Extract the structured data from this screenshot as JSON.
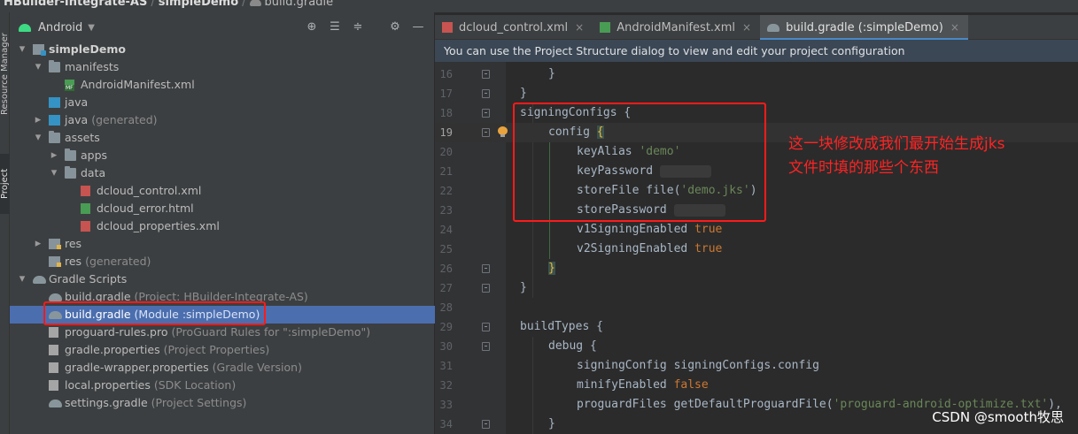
{
  "title_bar": {
    "project": "HBuilder-Integrate-AS",
    "module": "simpleDemo",
    "file": "build.gradle"
  },
  "tool_windows": {
    "resource_manager": "Resource Manager",
    "project": "Project"
  },
  "project_panel": {
    "view_mode": "Android",
    "tree": [
      {
        "label": "simpleDemo",
        "hint": "",
        "depth": 0,
        "arrow": "down",
        "icon": "module-icon",
        "bold": true
      },
      {
        "label": "manifests",
        "hint": "",
        "depth": 1,
        "arrow": "down",
        "icon": "folder-icon"
      },
      {
        "label": "AndroidManifest.xml",
        "hint": "",
        "depth": 2,
        "arrow": "",
        "icon": "manifest-icon"
      },
      {
        "label": "java",
        "hint": "",
        "depth": 1,
        "arrow": "",
        "icon": "source-folder-icon"
      },
      {
        "label": "java",
        "hint": "(generated)",
        "depth": 1,
        "arrow": "right",
        "icon": "generated-folder-icon"
      },
      {
        "label": "assets",
        "hint": "",
        "depth": 1,
        "arrow": "down",
        "icon": "folder-icon"
      },
      {
        "label": "apps",
        "hint": "",
        "depth": 2,
        "arrow": "right",
        "icon": "folder-icon"
      },
      {
        "label": "data",
        "hint": "",
        "depth": 2,
        "arrow": "down",
        "icon": "folder-icon"
      },
      {
        "label": "dcloud_control.xml",
        "hint": "",
        "depth": 3,
        "arrow": "",
        "icon": "xml-file-icon"
      },
      {
        "label": "dcloud_error.html",
        "hint": "",
        "depth": 3,
        "arrow": "",
        "icon": "html-file-icon"
      },
      {
        "label": "dcloud_properties.xml",
        "hint": "",
        "depth": 3,
        "arrow": "",
        "icon": "xml-file-icon"
      },
      {
        "label": "res",
        "hint": "",
        "depth": 1,
        "arrow": "right",
        "icon": "res-folder-icon"
      },
      {
        "label": "res",
        "hint": "(generated)",
        "depth": 1,
        "arrow": "",
        "icon": "res-folder-icon"
      },
      {
        "label": "Gradle Scripts",
        "hint": "",
        "depth": 0,
        "arrow": "down",
        "icon": "gradle-icon"
      },
      {
        "label": "build.gradle",
        "hint": "(Project: HBuilder-Integrate-AS)",
        "depth": 1,
        "arrow": "",
        "icon": "gradle-icon"
      },
      {
        "label": "build.gradle",
        "hint": "(Module :simpleDemo)",
        "depth": 1,
        "arrow": "",
        "icon": "gradle-icon",
        "selected": true
      },
      {
        "label": "proguard-rules.pro",
        "hint": "(ProGuard Rules for \":simpleDemo\")",
        "depth": 1,
        "arrow": "",
        "icon": "proguard-file-icon"
      },
      {
        "label": "gradle.properties",
        "hint": "(Project Properties)",
        "depth": 1,
        "arrow": "",
        "icon": "properties-file-icon"
      },
      {
        "label": "gradle-wrapper.properties",
        "hint": "(Gradle Version)",
        "depth": 1,
        "arrow": "",
        "icon": "properties-file-icon"
      },
      {
        "label": "local.properties",
        "hint": "(SDK Location)",
        "depth": 1,
        "arrow": "",
        "icon": "properties-file-icon"
      },
      {
        "label": "settings.gradle",
        "hint": "(Project Settings)",
        "depth": 1,
        "arrow": "",
        "icon": "gradle-icon"
      }
    ]
  },
  "editor": {
    "tabs": [
      {
        "label": "dcloud_control.xml",
        "icon": "xml-file-icon",
        "active": false
      },
      {
        "label": "AndroidManifest.xml",
        "icon": "manifest-icon",
        "active": false
      },
      {
        "label": "build.gradle (:simpleDemo)",
        "icon": "gradle-icon",
        "active": true
      }
    ],
    "notification": "You can use the Project Structure dialog to view and edit your project configuration",
    "caret_line": 19,
    "lines": [
      {
        "n": 16,
        "indent": 1,
        "tokens": [
          [
            "p",
            "}"
          ]
        ],
        "fold": true
      },
      {
        "n": 17,
        "indent": 0,
        "tokens": [
          [
            "p",
            "}"
          ]
        ],
        "fold": true
      },
      {
        "n": 18,
        "indent": 0,
        "tokens": [
          [
            "p",
            "signingConfigs {"
          ]
        ],
        "fold": true
      },
      {
        "n": 19,
        "indent": 1,
        "tokens": [
          [
            "p",
            "config "
          ],
          [
            "hl",
            "{"
          ]
        ],
        "fold": true,
        "bulb": true
      },
      {
        "n": 20,
        "indent": 2,
        "tokens": [
          [
            "p",
            "keyAlias "
          ],
          [
            "s",
            "'demo'"
          ]
        ]
      },
      {
        "n": 21,
        "indent": 2,
        "tokens": [
          [
            "p",
            "keyPassword "
          ],
          [
            "blur",
            ""
          ]
        ]
      },
      {
        "n": 22,
        "indent": 2,
        "tokens": [
          [
            "p",
            "storeFile file("
          ],
          [
            "s",
            "'demo.jks'"
          ],
          [
            "p",
            ")"
          ]
        ]
      },
      {
        "n": 23,
        "indent": 2,
        "tokens": [
          [
            "p",
            "storePassword "
          ],
          [
            "blur",
            ""
          ]
        ]
      },
      {
        "n": 24,
        "indent": 2,
        "tokens": [
          [
            "p",
            "v1SigningEnabled "
          ],
          [
            "k",
            "true"
          ]
        ]
      },
      {
        "n": 25,
        "indent": 2,
        "tokens": [
          [
            "p",
            "v2SigningEnabled "
          ],
          [
            "k",
            "true"
          ]
        ]
      },
      {
        "n": 26,
        "indent": 1,
        "tokens": [
          [
            "hl",
            "}"
          ]
        ],
        "fold": true
      },
      {
        "n": 27,
        "indent": 0,
        "tokens": [
          [
            "p",
            "}"
          ]
        ],
        "fold": true
      },
      {
        "n": 28,
        "indent": 0,
        "tokens": []
      },
      {
        "n": 29,
        "indent": 0,
        "tokens": [
          [
            "p",
            "buildTypes {"
          ]
        ],
        "fold": true
      },
      {
        "n": 30,
        "indent": 1,
        "tokens": [
          [
            "p",
            "debug {"
          ]
        ],
        "fold": true
      },
      {
        "n": 31,
        "indent": 2,
        "tokens": [
          [
            "p",
            "signingConfig signingConfigs.config"
          ]
        ]
      },
      {
        "n": 32,
        "indent": 2,
        "tokens": [
          [
            "p",
            "minifyEnabled "
          ],
          [
            "k",
            "false"
          ]
        ]
      },
      {
        "n": 33,
        "indent": 2,
        "tokens": [
          [
            "p",
            "proguardFiles getDefaultProguardFile("
          ],
          [
            "s",
            "'proguard-android-optimize.txt'"
          ],
          [
            "p",
            "),"
          ]
        ]
      },
      {
        "n": 34,
        "indent": 1,
        "tokens": [
          [
            "p",
            "}"
          ]
        ],
        "fold": true
      }
    ]
  },
  "annotation": {
    "line1": "这一块修改成我们最开始生成jks",
    "line2": "文件时填的那些个东西"
  },
  "watermark": "CSDN @smooth牧思",
  "colors": {
    "selection": "#4b6eaf",
    "annotation_red": "#ff1a1a",
    "keyword": "#cc7832",
    "string": "#6a8759",
    "brace_highlight": "#e8ba36"
  }
}
